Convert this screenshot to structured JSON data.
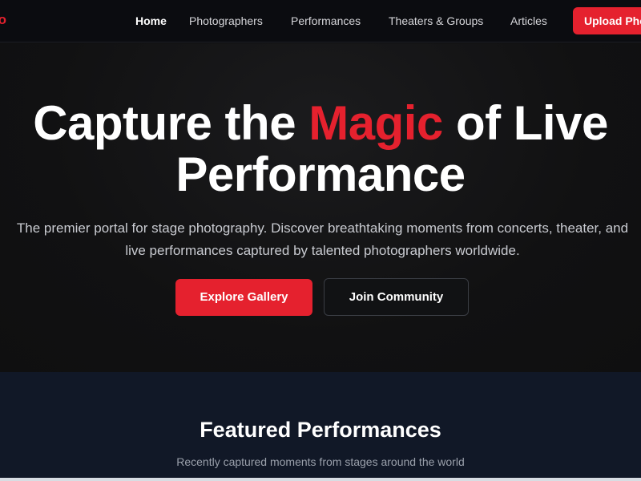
{
  "brand": {
    "logo_text": "to",
    "accent_color": "#e5212e"
  },
  "nav": {
    "links": [
      {
        "label": "Home",
        "active": true
      },
      {
        "label": "Photographers",
        "active": false
      },
      {
        "label": "Performances",
        "active": false
      },
      {
        "label": "Theaters & Groups",
        "active": false
      },
      {
        "label": "Articles",
        "active": false
      }
    ],
    "upload_label": "Upload Photo"
  },
  "hero": {
    "title_before": "Capture the ",
    "title_accent": "Magic",
    "title_after": " of Live Performance",
    "subtitle": "The premier portal for stage photography. Discover breathtaking moments from concerts, theater, and live performances captured by talented photographers worldwide.",
    "primary_button": "Explore Gallery",
    "secondary_button": "Join Community"
  },
  "featured": {
    "title": "Featured Performances",
    "subtitle": "Recently captured moments from stages around the world"
  }
}
